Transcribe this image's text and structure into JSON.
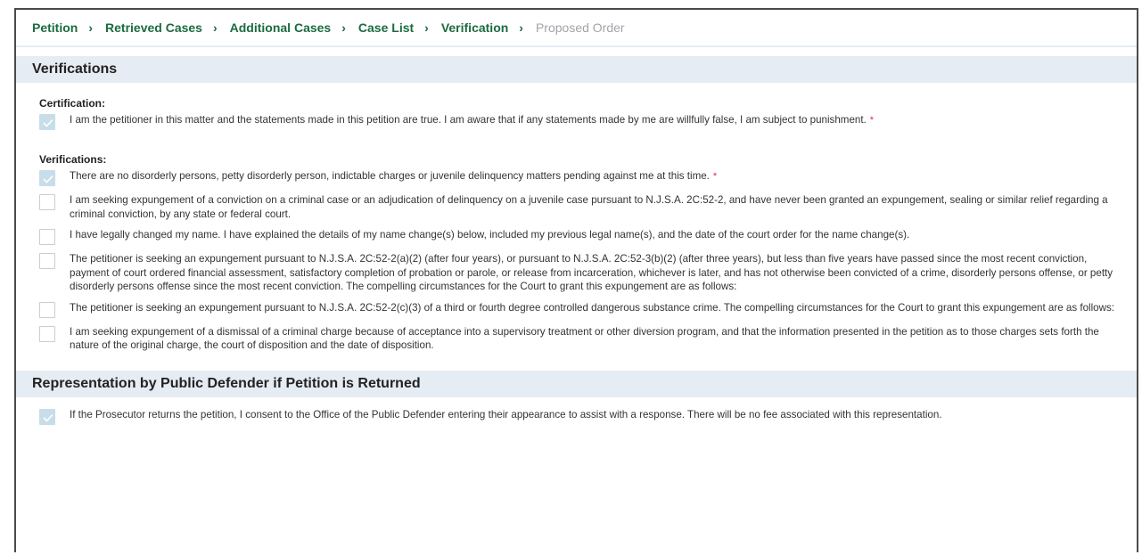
{
  "breadcrumb": [
    {
      "label": "Petition"
    },
    {
      "label": "Retrieved Cases"
    },
    {
      "label": "Additional Cases"
    },
    {
      "label": "Case List"
    },
    {
      "label": "Verification"
    },
    {
      "label": "Proposed Order"
    }
  ],
  "verifications_section": {
    "title": "Verifications",
    "certification": {
      "label": "Certification:",
      "items": [
        {
          "text": "I am the petitioner in this matter and the statements made in this petition are true. I am aware that if any statements made by me are willfully false, I am subject to punishment.",
          "checked": true,
          "required": true
        }
      ]
    },
    "verifications": {
      "label": "Verifications:",
      "items": [
        {
          "text": "There are no disorderly persons, petty disorderly person, indictable charges or juvenile delinquency matters pending against me at this time.",
          "checked": true,
          "required": true
        },
        {
          "text": "I am seeking expungement of a conviction on a criminal case or an adjudication of delinquency on a juvenile case pursuant to N.J.S.A. 2C:52-2, and have never been granted an expungement, sealing or similar relief regarding a criminal conviction, by any state or federal court.",
          "checked": false,
          "required": false
        },
        {
          "text": "I have legally changed my name. I have explained the details of my name change(s) below, included my previous legal name(s), and the date of the court order for the name change(s).",
          "checked": false,
          "required": false
        },
        {
          "text": "The petitioner is seeking an expungement pursuant to N.J.S.A. 2C:52-2(a)(2) (after four years), or pursuant to N.J.S.A. 2C:52-3(b)(2) (after three years), but less than five years have passed since the most recent conviction, payment of court ordered financial assessment, satisfactory completion of probation or parole, or release from incarceration, whichever is later, and has not otherwise been convicted of a crime, disorderly persons offense, or petty disorderly persons offense since the most recent conviction. The compelling circumstances for the Court to grant this expungement are as follows:",
          "checked": false,
          "required": false
        },
        {
          "text": "The petitioner is seeking an expungement pursuant to N.J.S.A. 2C:52-2(c)(3) of a third or fourth degree controlled dangerous substance crime. The compelling circumstances for the Court to grant this expungement are as follows:",
          "checked": false,
          "required": false
        },
        {
          "text": "I am seeking expungement of a dismissal of a criminal charge because of acceptance into a supervisory treatment or other diversion program, and that the information presented in the petition as to those charges sets forth the nature of the original charge, the court of disposition and the date of disposition.",
          "checked": false,
          "required": false
        }
      ]
    }
  },
  "representation_section": {
    "title": "Representation by Public Defender if Petition is Returned",
    "items": [
      {
        "text": "If the Prosecutor returns the petition, I consent to the Office of the Public Defender entering their appearance to assist with a response. There will be no fee associated with this representation.",
        "checked": true,
        "required": false
      }
    ]
  },
  "required_marker": "*",
  "colors": {
    "accent_green": "#1b6b40",
    "section_bg": "#e6ecf3",
    "checked_bg": "#c7dde9",
    "required_red": "#d0314b"
  }
}
